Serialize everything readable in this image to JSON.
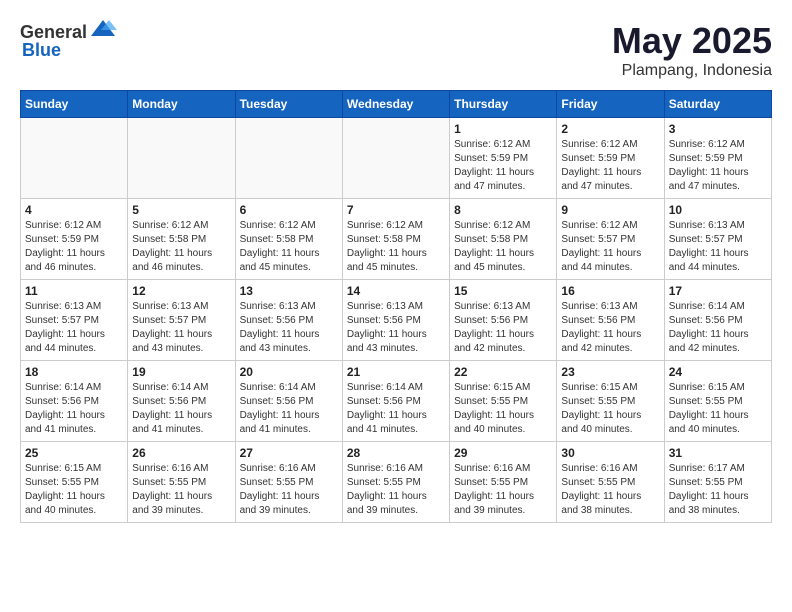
{
  "header": {
    "logo_general": "General",
    "logo_blue": "Blue",
    "month": "May 2025",
    "location": "Plampang, Indonesia"
  },
  "weekdays": [
    "Sunday",
    "Monday",
    "Tuesday",
    "Wednesday",
    "Thursday",
    "Friday",
    "Saturday"
  ],
  "weeks": [
    [
      {
        "day": "",
        "empty": true
      },
      {
        "day": "",
        "empty": true
      },
      {
        "day": "",
        "empty": true
      },
      {
        "day": "",
        "empty": true
      },
      {
        "day": "1",
        "sunrise": "6:12 AM",
        "sunset": "5:59 PM",
        "daylight": "11 hours and 47 minutes."
      },
      {
        "day": "2",
        "sunrise": "6:12 AM",
        "sunset": "5:59 PM",
        "daylight": "11 hours and 47 minutes."
      },
      {
        "day": "3",
        "sunrise": "6:12 AM",
        "sunset": "5:59 PM",
        "daylight": "11 hours and 47 minutes."
      }
    ],
    [
      {
        "day": "4",
        "sunrise": "6:12 AM",
        "sunset": "5:59 PM",
        "daylight": "11 hours and 46 minutes."
      },
      {
        "day": "5",
        "sunrise": "6:12 AM",
        "sunset": "5:58 PM",
        "daylight": "11 hours and 46 minutes."
      },
      {
        "day": "6",
        "sunrise": "6:12 AM",
        "sunset": "5:58 PM",
        "daylight": "11 hours and 45 minutes."
      },
      {
        "day": "7",
        "sunrise": "6:12 AM",
        "sunset": "5:58 PM",
        "daylight": "11 hours and 45 minutes."
      },
      {
        "day": "8",
        "sunrise": "6:12 AM",
        "sunset": "5:58 PM",
        "daylight": "11 hours and 45 minutes."
      },
      {
        "day": "9",
        "sunrise": "6:12 AM",
        "sunset": "5:57 PM",
        "daylight": "11 hours and 44 minutes."
      },
      {
        "day": "10",
        "sunrise": "6:13 AM",
        "sunset": "5:57 PM",
        "daylight": "11 hours and 44 minutes."
      }
    ],
    [
      {
        "day": "11",
        "sunrise": "6:13 AM",
        "sunset": "5:57 PM",
        "daylight": "11 hours and 44 minutes."
      },
      {
        "day": "12",
        "sunrise": "6:13 AM",
        "sunset": "5:57 PM",
        "daylight": "11 hours and 43 minutes."
      },
      {
        "day": "13",
        "sunrise": "6:13 AM",
        "sunset": "5:56 PM",
        "daylight": "11 hours and 43 minutes."
      },
      {
        "day": "14",
        "sunrise": "6:13 AM",
        "sunset": "5:56 PM",
        "daylight": "11 hours and 43 minutes."
      },
      {
        "day": "15",
        "sunrise": "6:13 AM",
        "sunset": "5:56 PM",
        "daylight": "11 hours and 42 minutes."
      },
      {
        "day": "16",
        "sunrise": "6:13 AM",
        "sunset": "5:56 PM",
        "daylight": "11 hours and 42 minutes."
      },
      {
        "day": "17",
        "sunrise": "6:14 AM",
        "sunset": "5:56 PM",
        "daylight": "11 hours and 42 minutes."
      }
    ],
    [
      {
        "day": "18",
        "sunrise": "6:14 AM",
        "sunset": "5:56 PM",
        "daylight": "11 hours and 41 minutes."
      },
      {
        "day": "19",
        "sunrise": "6:14 AM",
        "sunset": "5:56 PM",
        "daylight": "11 hours and 41 minutes."
      },
      {
        "day": "20",
        "sunrise": "6:14 AM",
        "sunset": "5:56 PM",
        "daylight": "11 hours and 41 minutes."
      },
      {
        "day": "21",
        "sunrise": "6:14 AM",
        "sunset": "5:56 PM",
        "daylight": "11 hours and 41 minutes."
      },
      {
        "day": "22",
        "sunrise": "6:15 AM",
        "sunset": "5:55 PM",
        "daylight": "11 hours and 40 minutes."
      },
      {
        "day": "23",
        "sunrise": "6:15 AM",
        "sunset": "5:55 PM",
        "daylight": "11 hours and 40 minutes."
      },
      {
        "day": "24",
        "sunrise": "6:15 AM",
        "sunset": "5:55 PM",
        "daylight": "11 hours and 40 minutes."
      }
    ],
    [
      {
        "day": "25",
        "sunrise": "6:15 AM",
        "sunset": "5:55 PM",
        "daylight": "11 hours and 40 minutes."
      },
      {
        "day": "26",
        "sunrise": "6:16 AM",
        "sunset": "5:55 PM",
        "daylight": "11 hours and 39 minutes."
      },
      {
        "day": "27",
        "sunrise": "6:16 AM",
        "sunset": "5:55 PM",
        "daylight": "11 hours and 39 minutes."
      },
      {
        "day": "28",
        "sunrise": "6:16 AM",
        "sunset": "5:55 PM",
        "daylight": "11 hours and 39 minutes."
      },
      {
        "day": "29",
        "sunrise": "6:16 AM",
        "sunset": "5:55 PM",
        "daylight": "11 hours and 39 minutes."
      },
      {
        "day": "30",
        "sunrise": "6:16 AM",
        "sunset": "5:55 PM",
        "daylight": "11 hours and 38 minutes."
      },
      {
        "day": "31",
        "sunrise": "6:17 AM",
        "sunset": "5:55 PM",
        "daylight": "11 hours and 38 minutes."
      }
    ]
  ],
  "labels": {
    "sunrise": "Sunrise:",
    "sunset": "Sunset:",
    "daylight": "Daylight:"
  }
}
